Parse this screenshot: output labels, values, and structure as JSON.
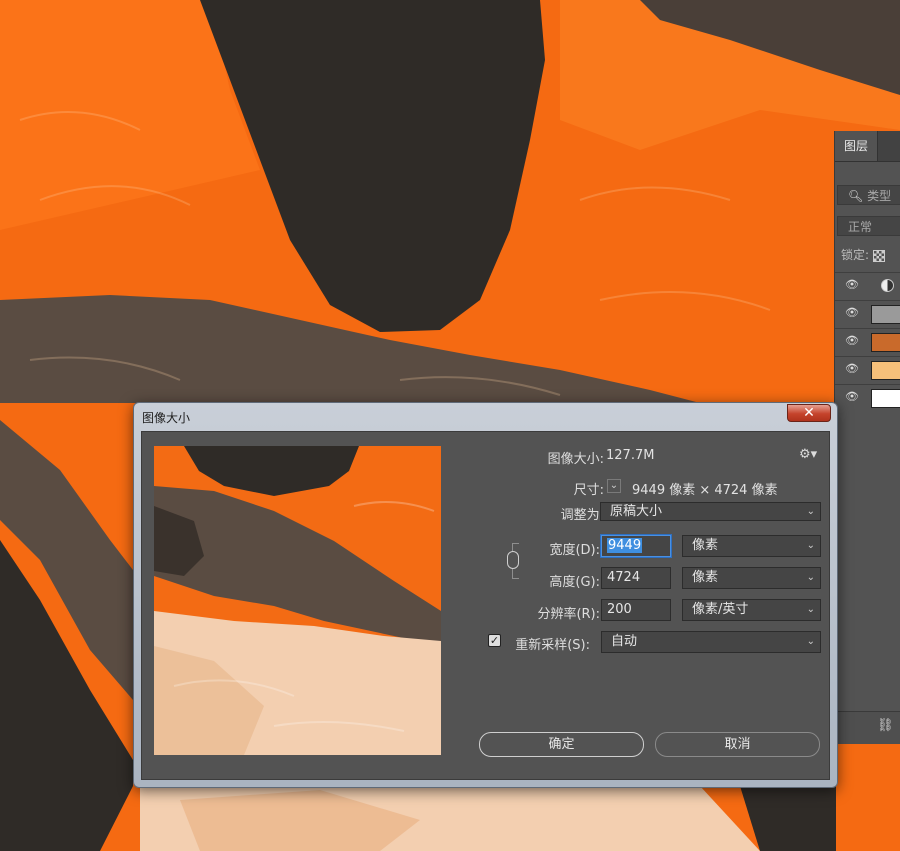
{
  "layers_panel": {
    "tab": "图层",
    "search_placeholder": "类型",
    "blend_mode": "正常",
    "lock_label": "锁定:",
    "layers": [
      {
        "visible": true,
        "thumb_color": "#6a6a6a"
      },
      {
        "visible": true,
        "thumb_color": "#9a9a9a"
      },
      {
        "visible": true,
        "thumb_color": "#c96a2b"
      },
      {
        "visible": true,
        "thumb_color": "#f6c07a"
      },
      {
        "visible": true,
        "thumb_color": "#ffffff"
      }
    ]
  },
  "dialog": {
    "title": "图像大小",
    "close_label": "✕",
    "image_size_label": "图像大小:",
    "image_size_value": "127.7M",
    "dimensions_label": "尺寸:",
    "dimensions_value": "9449 像素  ×  4724 像素",
    "fit_to_label": "调整为:",
    "fit_to_value": "原稿大小",
    "width_label": "宽度(D):",
    "width_value": "9449",
    "width_unit": "像素",
    "height_label": "高度(G):",
    "height_value": "4724",
    "height_unit": "像素",
    "resolution_label": "分辨率(R):",
    "resolution_value": "200",
    "resolution_unit": "像素/英寸",
    "resample_label": "重新采样(S):",
    "resample_checked": true,
    "resample_value": "自动",
    "ok_label": "确定",
    "cancel_label": "取消"
  },
  "colors": {
    "orange": "#f56a12",
    "dark_brown": "#2f2b27",
    "mid_brown": "#5a4c42",
    "cream": "#f3cfb0",
    "dialog_bg": "#535353"
  }
}
